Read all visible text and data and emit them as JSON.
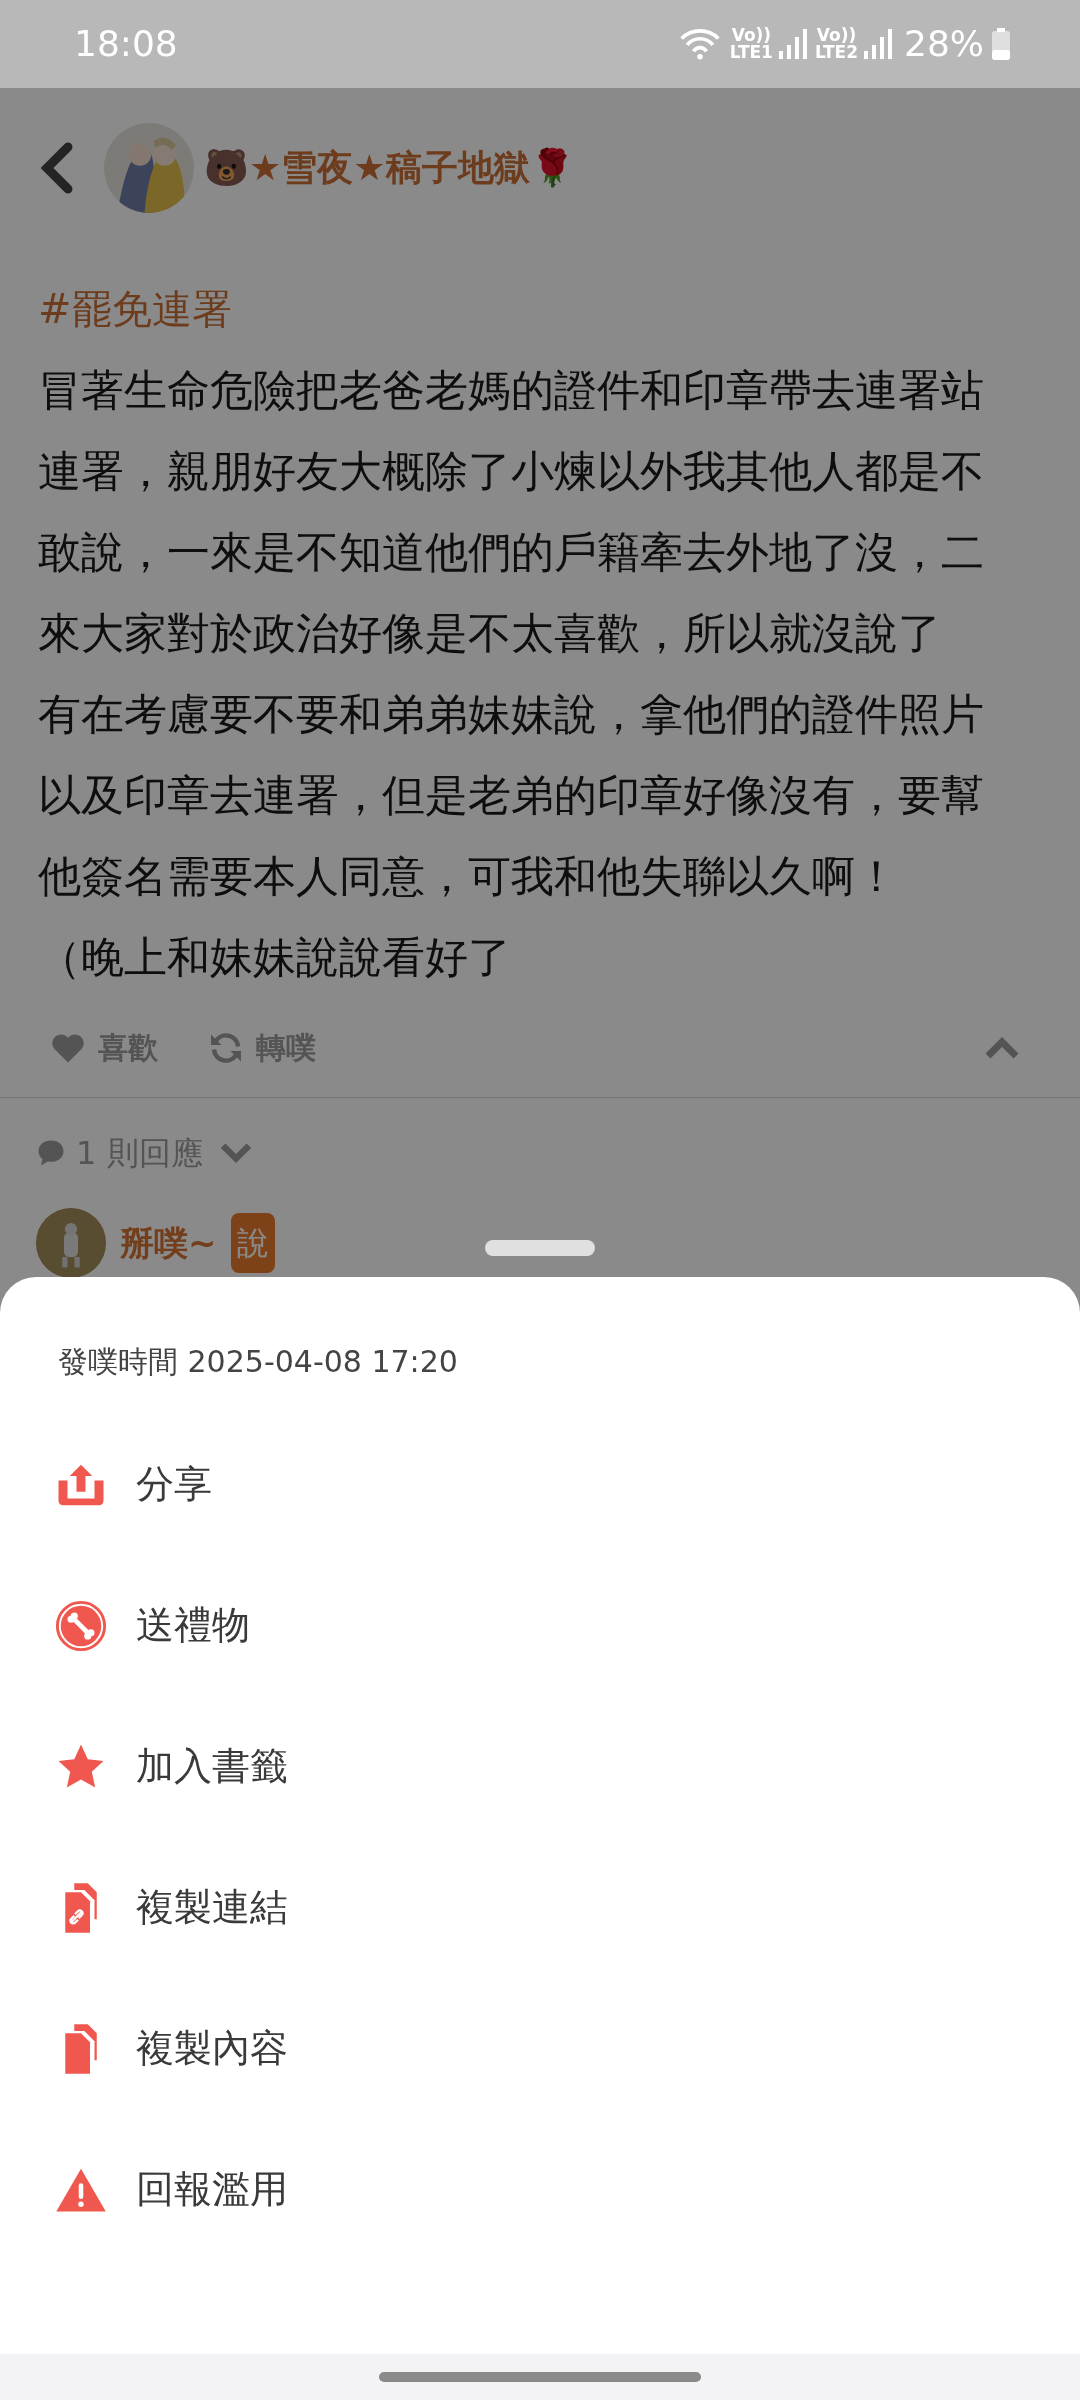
{
  "status_bar": {
    "time": "18:08",
    "sims": [
      {
        "volte": "Vo))",
        "network": "LTE1"
      },
      {
        "volte": "Vo))",
        "network": "LTE2"
      }
    ],
    "battery": "28%"
  },
  "header": {
    "author": "🐻★雪夜★稿子地獄🌹"
  },
  "post": {
    "hashtag": "#罷免連署",
    "lines": [
      "冒著生命危險把老爸老媽的證件和印章帶去連署站",
      "連署，親朋好友大概除了小煉以外我其他人都是不",
      "敢說，一來是不知道他們的戶籍牽去外地了沒，二",
      "來大家對於政治好像是不太喜歡，所以就沒說了",
      "有在考慮要不要和弟弟妹妹說，拿他們的證件照片",
      "以及印章去連署，但是老弟的印章好像沒有，要幫",
      "他簽名需要本人同意，可我和他失聯以久啊！",
      "（晚上和妹妹說說看好了"
    ],
    "actions": [
      {
        "kind": "like",
        "label": "喜歡"
      },
      {
        "kind": "replurk",
        "label": "轉噗"
      }
    ]
  },
  "replies": {
    "count_label": "1 則回應",
    "first": {
      "author": "掰噗~",
      "badge": "說"
    }
  },
  "sheet": {
    "posted_time": "發噗時間 2025-04-08 17:20",
    "items": [
      {
        "kind": "share",
        "label": "分享"
      },
      {
        "kind": "gift",
        "label": "送禮物"
      },
      {
        "kind": "bookmark",
        "label": "加入書籤"
      },
      {
        "kind": "copy_link",
        "label": "複製連結"
      },
      {
        "kind": "copy_content",
        "label": "複製內容"
      },
      {
        "kind": "report",
        "label": "回報濫用"
      }
    ]
  }
}
